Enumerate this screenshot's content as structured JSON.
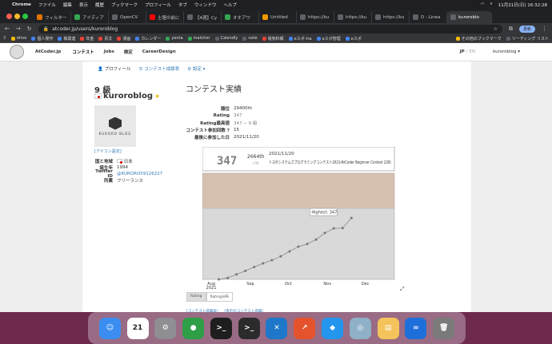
{
  "menubar": {
    "app": "Chrome",
    "items": [
      "ファイル",
      "編集",
      "表示",
      "履歴",
      "ブックマーク",
      "プロフィール",
      "タブ",
      "ウィンドウ",
      "ヘルプ"
    ],
    "clock": "11月21日(日) 16:32:28"
  },
  "tabs": [
    {
      "label": "フィルター",
      "color": "#e37400"
    },
    {
      "label": "アイディア",
      "color": "#34a853"
    },
    {
      "label": "OpenCV",
      "color": "#5f6368"
    },
    {
      "label": "土壇の前に",
      "color": "#ff0000"
    },
    {
      "label": "【4週】Cy",
      "color": "#5f6368"
    },
    {
      "label": "オオアワ",
      "color": "#34a853"
    },
    {
      "label": "Untitled",
      "color": "#f29900"
    },
    {
      "label": "https://ku",
      "color": "#5f6368"
    },
    {
      "label": "https://ku",
      "color": "#5f6368"
    },
    {
      "label": "https://ku",
      "color": "#5f6368"
    },
    {
      "label": "D - Linea",
      "color": "#5f6368"
    },
    {
      "label": "kuroroblo",
      "color": "#5f6368",
      "active": true
    }
  ],
  "address": {
    "url": "atcoder.jp/users/kuroroblog",
    "update_label": "更新"
  },
  "bookmarks": [
    "drive",
    "個人発作",
    "株関連",
    "年金",
    "青文",
    "漫画",
    "カレンダー",
    "yenta",
    "matcher",
    "Calendly",
    "note",
    "電気料報",
    "eスポ-tra",
    "eスポ管理",
    "eスポ",
    "その他のブックマーク",
    "リーディング リスト"
  ],
  "site": {
    "brand": "AtCoder.jp",
    "nav": [
      "コンテスト",
      "Jobs",
      "検定",
      "CareerDesign"
    ],
    "lang_jp": "JP",
    "lang_en": "EN",
    "user_menu": "kuroroblog"
  },
  "subnav": {
    "profile": "プロフィール",
    "history": "コンテスト成績表",
    "settings": "設定"
  },
  "user": {
    "grade": "9 級",
    "name": "kuroroblog",
    "icon_setting": "[アイコン設定]",
    "avatar_text": "KURORO BLOG",
    "profile": [
      {
        "k": "国と地域",
        "v": "日本"
      },
      {
        "k": "誕生年",
        "v": "1994"
      },
      {
        "k": "Twitter ID",
        "v": "@KURORO59126227"
      },
      {
        "k": "所属",
        "v": "フリーランス"
      }
    ]
  },
  "contest": {
    "heading": "コンテスト実績",
    "stats": [
      {
        "k": "順位",
        "v": "29400th"
      },
      {
        "k": "Rating",
        "v": "347"
      },
      {
        "k": "Rating最高値",
        "v": "347 − 9 級"
      },
      {
        "k": "コンテスト参加回数 ?",
        "v": "15"
      },
      {
        "k": "最後に参加した日",
        "v": "2021/11/20"
      }
    ]
  },
  "chart_data": {
    "type": "line",
    "info": {
      "rating": "347",
      "rank": "2664th",
      "delta": "+59",
      "date": "2021/11/20",
      "contest": "トヨタシステムズプログラミングコンテスト2021(AtCoder Beginner Contest 228)"
    },
    "tooltip": "Highest: 347",
    "x_ticks": [
      "Aug 2021",
      "Sep",
      "Oct",
      "Nov",
      "Dec"
    ],
    "y_ticks": [
      0,
      400
    ],
    "ylim": [
      0,
      600
    ],
    "x": [
      "2021-08-07",
      "2021-08-14",
      "2021-08-21",
      "2021-08-28",
      "2021-09-04",
      "2021-09-11",
      "2021-09-18",
      "2021-09-25",
      "2021-10-02",
      "2021-10-09",
      "2021-10-16",
      "2021-10-23",
      "2021-10-30",
      "2021-11-06",
      "2021-11-13",
      "2021-11-20"
    ],
    "values": [
      0,
      8,
      28,
      48,
      70,
      90,
      108,
      130,
      158,
      185,
      200,
      225,
      262,
      288,
      290,
      347
    ],
    "bands": [
      {
        "from": 0,
        "to": 400,
        "color": "#d9d9d9"
      },
      {
        "from": 400,
        "to": 600,
        "color": "#d7c0b0"
      }
    ]
  },
  "chart_tabs": [
    "Rating",
    "Rating分布"
  ],
  "bottom_links": [
    "[コンテスト成績表]",
    "[直近のコンテスト成績]"
  ],
  "dock": [
    {
      "name": "finder",
      "color": "#3b8ef0",
      "glyph": "☺"
    },
    {
      "name": "calendar",
      "color": "#ffffff",
      "glyph": "21"
    },
    {
      "name": "settings",
      "color": "#8e8e93",
      "glyph": "⚙"
    },
    {
      "name": "chrome",
      "color": "#2e9e47",
      "glyph": "●"
    },
    {
      "name": "terminal-a",
      "color": "#1e1e1e",
      "glyph": ">_"
    },
    {
      "name": "terminal-b",
      "color": "#2b2b2b",
      "glyph": ">_"
    },
    {
      "name": "vscode",
      "color": "#1f77c9",
      "glyph": "✕"
    },
    {
      "name": "grapher",
      "color": "#e5532d",
      "glyph": "↗"
    },
    {
      "name": "docker",
      "color": "#2496ed",
      "glyph": "◆"
    },
    {
      "name": "preview",
      "color": "#8fb0c7",
      "glyph": "◎"
    },
    {
      "name": "notes",
      "color": "#f5c35b",
      "glyph": "▤"
    },
    {
      "name": "infinity",
      "color": "#1e6fd9",
      "glyph": "∞"
    },
    {
      "name": "trash",
      "color": "#7a7a7a",
      "glyph": "🗑"
    }
  ]
}
